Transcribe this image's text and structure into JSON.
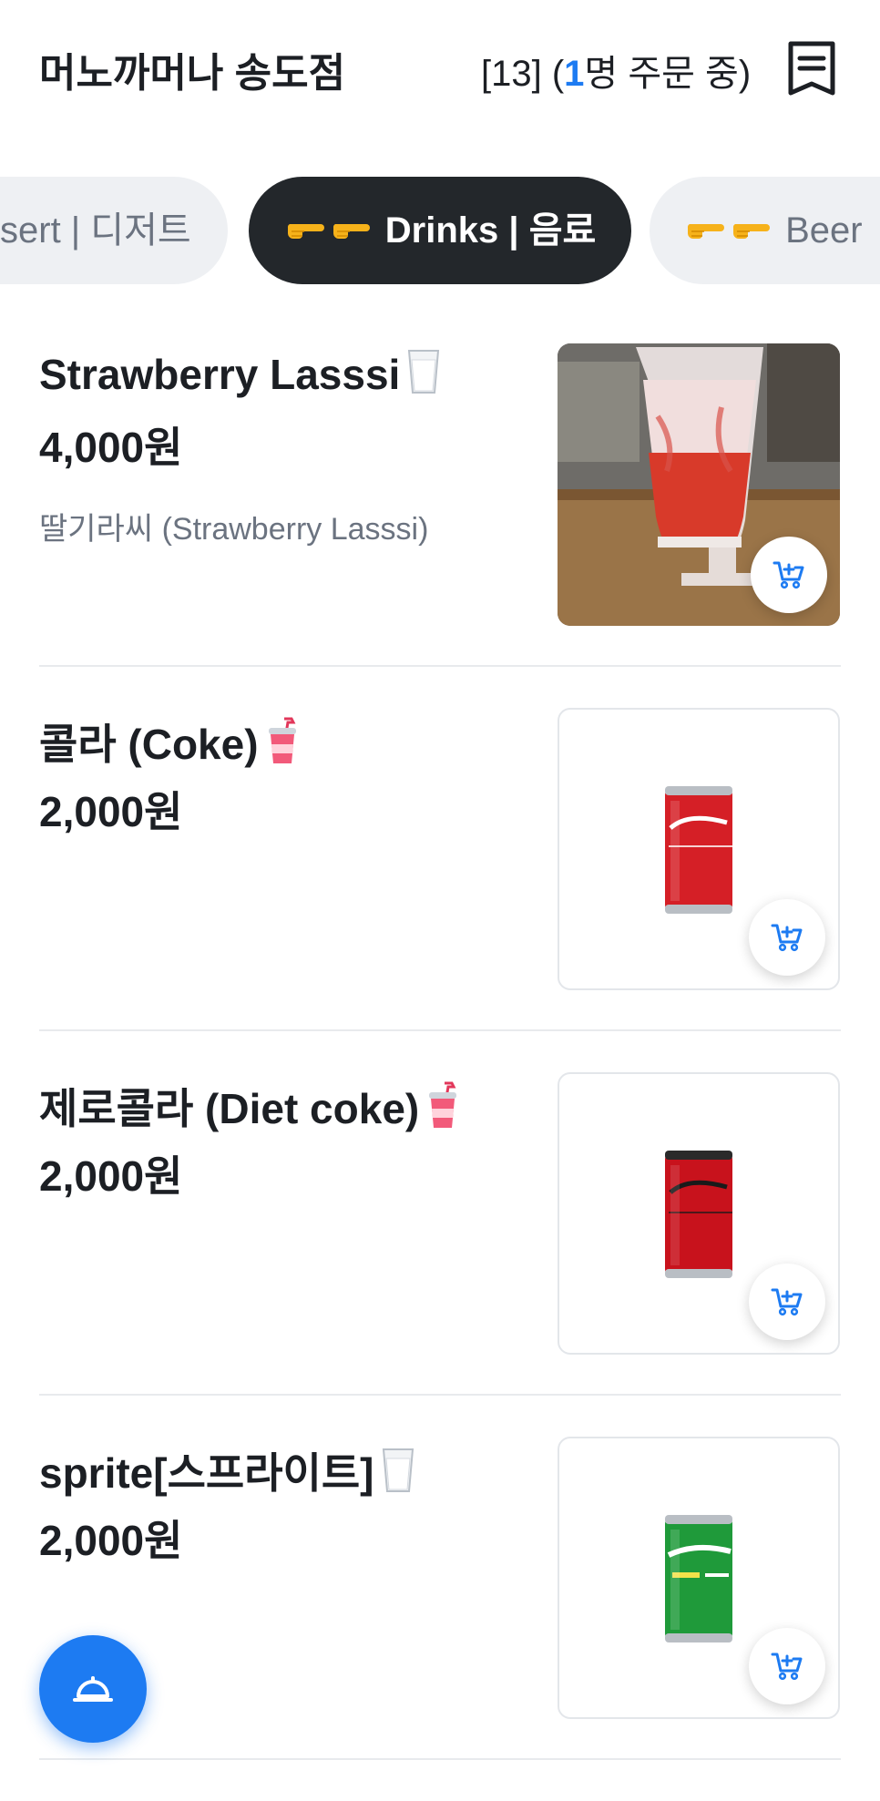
{
  "header": {
    "store_name": "머노까머나 송도점",
    "table_prefix": "[13] (",
    "order_count": "1",
    "order_suffix": "명 주문 중)"
  },
  "tabs": [
    {
      "label": "sert | 디저트",
      "active": false
    },
    {
      "label": "Drinks | 음료",
      "active": true,
      "icon": "pointing-hands-emoji"
    },
    {
      "label": "Beer",
      "active": false,
      "icon": "pointing-hands-emoji"
    }
  ],
  "items": [
    {
      "name": "Strawberry Lasssi",
      "price": "4,000원",
      "description": "딸기라씨 (Strawberry Lasssi)",
      "icon": "glass-of-milk-emoji",
      "image": "strawberry-lassi-photo"
    },
    {
      "name": "콜라 (Coke)",
      "price": "2,000원",
      "icon": "cup-with-straw-emoji",
      "image": "coca-cola-can"
    },
    {
      "name": "제로콜라 (Diet coke)",
      "price": "2,000원",
      "icon": "cup-with-straw-emoji",
      "image": "coca-cola-zero-can"
    },
    {
      "name": "sprite[스프라이트]",
      "price": "2,000원",
      "icon": "glass-of-milk-emoji",
      "image": "sprite-can"
    }
  ],
  "colors": {
    "accent": "#1d7bf2",
    "active_tab": "#23272b",
    "text": "#1c1f24",
    "muted": "#6b7380"
  }
}
